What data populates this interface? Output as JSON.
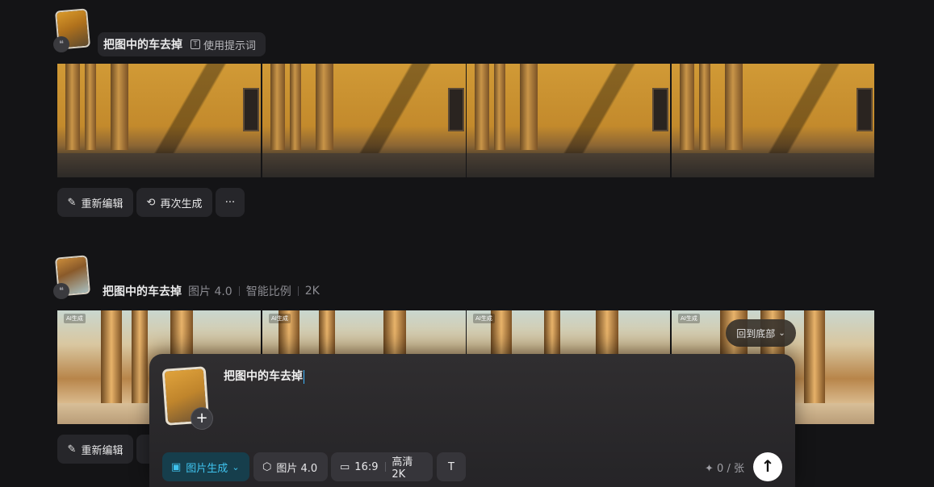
{
  "entries": [
    {
      "prompt": "把图中的车去掉",
      "hint_label": "使用提示词"
    },
    {
      "prompt": "把图中的车去掉",
      "model": "图片 4.0",
      "ratio": "智能比例",
      "resolution": "2K",
      "ai_tag": "AI生成"
    }
  ],
  "actions": {
    "re_edit": "重新编辑",
    "regenerate": "再次生成",
    "more": "···"
  },
  "back_to_bottom": "回到底部",
  "composer": {
    "text": "把图中的车去掉",
    "mode": "图片生成",
    "model": "图片 4.0",
    "ratio": "16:9",
    "quality": "高清 2K",
    "credits": "0 / 张"
  },
  "colors": {
    "background": "#141416",
    "accent": "#3fc3ee",
    "panel": "#26262a"
  }
}
